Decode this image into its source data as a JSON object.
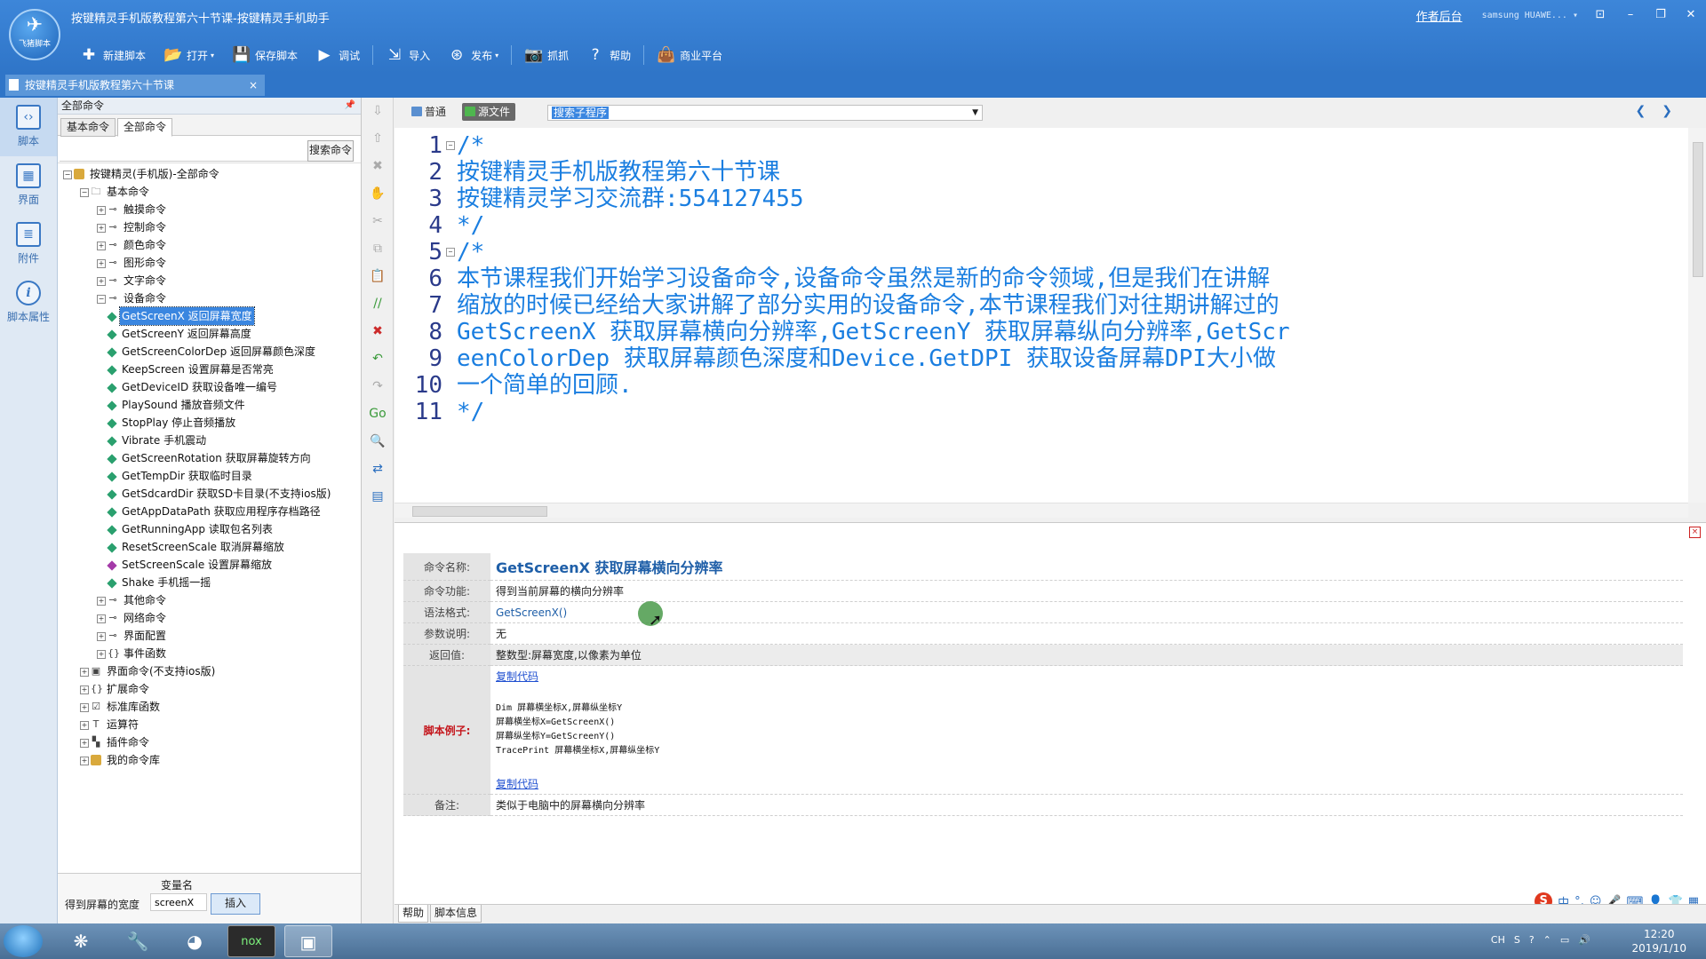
{
  "app": {
    "title": "按键精灵手机版教程第六十节课-按键精灵手机助手",
    "logo_text": "飞猪脚本",
    "author_link": "作者后台",
    "device": "samsung HUAWE...",
    "window_controls": [
      "⊡",
      "–",
      "❐",
      "✕"
    ]
  },
  "toolbar": [
    {
      "label": "新建脚本",
      "icon": "plus-icon",
      "glyph": "✚"
    },
    {
      "label": "打开",
      "icon": "folder-icon",
      "glyph": "📂",
      "dropdown": true
    },
    {
      "label": "保存脚本",
      "icon": "save-icon",
      "glyph": "💾"
    },
    {
      "label": "调试",
      "icon": "play-icon",
      "glyph": "▶"
    },
    {
      "label": "导入",
      "icon": "import-icon",
      "glyph": "⇲"
    },
    {
      "label": "发布",
      "icon": "publish-icon",
      "glyph": "⊛",
      "dropdown": true
    },
    {
      "label": "抓抓",
      "icon": "camera-icon",
      "glyph": "📷"
    },
    {
      "label": "帮助",
      "icon": "help-icon",
      "glyph": "?"
    },
    {
      "label": "商业平台",
      "icon": "bag-icon",
      "glyph": "👜"
    }
  ],
  "doc_tab": {
    "label": "按键精灵手机版教程第六十节课",
    "close": "×"
  },
  "rail": [
    {
      "label": "脚本",
      "icon": "script-icon",
      "glyph": "‹›"
    },
    {
      "label": "界面",
      "icon": "ui-grid-icon",
      "glyph": "▦"
    },
    {
      "label": "附件",
      "icon": "attachment-icon",
      "glyph": "≣"
    },
    {
      "label": "脚本属性",
      "icon": "info-icon",
      "glyph": "i"
    }
  ],
  "cmd_panel": {
    "header": "全部命令",
    "tabs": [
      "基本命令",
      "全部命令"
    ],
    "search_button": "搜索命令",
    "search_value": ""
  },
  "tree": [
    {
      "label": "按键精灵(手机版)-全部命令",
      "level": 0,
      "exp": "-",
      "icon": "root"
    },
    {
      "label": "基本命令",
      "level": 1,
      "exp": "-",
      "icon": "folder"
    },
    {
      "label": "触摸命令",
      "level": 2,
      "exp": "+",
      "icon": "key"
    },
    {
      "label": "控制命令",
      "level": 2,
      "exp": "+",
      "icon": "key"
    },
    {
      "label": "颜色命令",
      "level": 2,
      "exp": "+",
      "icon": "key"
    },
    {
      "label": "图形命令",
      "level": 2,
      "exp": "+",
      "icon": "key"
    },
    {
      "label": "文字命令",
      "level": 2,
      "exp": "+",
      "icon": "key"
    },
    {
      "label": "设备命令",
      "level": 2,
      "exp": "-",
      "icon": "key"
    },
    {
      "label": "GetScreenX 返回屏幕宽度",
      "level": 3,
      "icon": "leaf",
      "selected": true
    },
    {
      "label": "GetScreenY 返回屏幕高度",
      "level": 3,
      "icon": "leaf"
    },
    {
      "label": "GetScreenColorDep 返回屏幕颜色深度",
      "level": 3,
      "icon": "leaf"
    },
    {
      "label": "KeepScreen 设置屏幕是否常亮",
      "level": 3,
      "icon": "leaf"
    },
    {
      "label": "GetDeviceID 获取设备唯一编号",
      "level": 3,
      "icon": "leaf"
    },
    {
      "label": "PlaySound 播放音频文件",
      "level": 3,
      "icon": "leaf"
    },
    {
      "label": "StopPlay 停止音频播放",
      "level": 3,
      "icon": "leaf"
    },
    {
      "label": "Vibrate 手机震动",
      "level": 3,
      "icon": "leaf"
    },
    {
      "label": "GetScreenRotation 获取屏幕旋转方向",
      "level": 3,
      "icon": "leaf"
    },
    {
      "label": "GetTempDir 获取临时目录",
      "level": 3,
      "icon": "leaf"
    },
    {
      "label": "GetSdcardDir 获取SD卡目录(不支持ios版)",
      "level": 3,
      "icon": "leaf"
    },
    {
      "label": "GetAppDataPath 获取应用程序存档路径",
      "level": 3,
      "icon": "leaf"
    },
    {
      "label": "GetRunningApp 读取包名列表",
      "level": 3,
      "icon": "leaf"
    },
    {
      "label": "ResetScreenScale 取消屏幕缩放",
      "level": 3,
      "icon": "leaf"
    },
    {
      "label": "SetScreenScale 设置屏幕缩放",
      "level": 3,
      "icon": "leaf-purple"
    },
    {
      "label": "Shake 手机摇一摇",
      "level": 3,
      "icon": "leaf"
    },
    {
      "label": "其他命令",
      "level": 2,
      "exp": "+",
      "icon": "key"
    },
    {
      "label": "网络命令",
      "level": 2,
      "exp": "+",
      "icon": "key"
    },
    {
      "label": "界面配置",
      "level": 2,
      "exp": "+",
      "icon": "key"
    },
    {
      "label": "事件函数",
      "level": 2,
      "exp": "+",
      "icon": "brace"
    },
    {
      "label": "界面命令(不支持ios版)",
      "level": 1,
      "exp": "+",
      "icon": "ui"
    },
    {
      "label": "扩展命令",
      "level": 1,
      "exp": "+",
      "icon": "brace"
    },
    {
      "label": "标准库函数",
      "level": 1,
      "exp": "+",
      "icon": "lib"
    },
    {
      "label": "运算符",
      "level": 1,
      "exp": "+",
      "icon": "op"
    },
    {
      "label": "插件命令",
      "level": 1,
      "exp": "+",
      "icon": "plugin"
    },
    {
      "label": "我的命令库",
      "level": 1,
      "exp": "+",
      "icon": "root"
    }
  ],
  "var_area": {
    "header": "变量名",
    "desc": "得到屏幕的宽度",
    "value": "screenX",
    "insert_button": "插入"
  },
  "editor": {
    "mode_tabs": [
      "普通",
      "源文件"
    ],
    "active_mode": 1,
    "sub_select": "搜索子程序",
    "lines": [
      {
        "n": "1",
        "fold": "-",
        "text": "/*"
      },
      {
        "n": "2",
        "text": "按键精灵手机版教程第六十节课"
      },
      {
        "n": "3",
        "text": "按键精灵学习交流群:554127455"
      },
      {
        "n": "4",
        "text": "*/"
      },
      {
        "n": "5",
        "fold": "-",
        "text": "/*"
      },
      {
        "n": "6",
        "text": "本节课程我们开始学习设备命令,设备命令虽然是新的命令领域,但是我们在讲解"
      },
      {
        "n": "7",
        "text": "缩放的时候已经给大家讲解了部分实用的设备命令,本节课程我们对往期讲解过的"
      },
      {
        "n": "8",
        "text": "GetScreenX 获取屏幕横向分辨率,GetScreenY 获取屏幕纵向分辨率,GetScr"
      },
      {
        "n": "9",
        "text": "eenColorDep 获取屏幕颜色深度和Device.GetDPI 获取设备屏幕DPI大小做"
      },
      {
        "n": "10",
        "text": "一个简单的回顾."
      },
      {
        "n": "11",
        "text": "*/"
      }
    ]
  },
  "help": {
    "name_label": "命令名称:",
    "name_value": "GetScreenX 获取屏幕横向分辨率",
    "func_label": "命令功能:",
    "func_value": "得到当前屏幕的横向分辨率",
    "syntax_label": "语法格式:",
    "syntax_value": "GetScreenX()",
    "params_label": "参数说明:",
    "params_value": "无",
    "return_label": "返回值:",
    "return_value": "整数型:屏幕宽度,以像素为单位",
    "example_label": "脚本例子:",
    "copy_code": "复制代码",
    "example_lines": [
      "Dim 屏幕横坐标X,屏幕纵坐标Y",
      "屏幕横坐标X=GetScreenX()",
      "屏幕纵坐标Y=GetScreenY()",
      "TracePrint 屏幕横坐标X,屏幕纵坐标Y"
    ],
    "remark_label": "备注:",
    "remark_value": "类似于电脑中的屏幕横向分辨率"
  },
  "bottom_tabs": [
    "帮助",
    "脚本信息"
  ],
  "ime": [
    "S",
    "中",
    "°,",
    "☺",
    "🎤",
    "⌨",
    "👤",
    "👕",
    "▦"
  ],
  "taskbar": {
    "apps": [
      "❋",
      "🔧",
      "◕",
      "nox",
      "▣"
    ],
    "tray": [
      "CH",
      "S",
      "?",
      "⌃",
      "▭",
      "🔊"
    ],
    "time": "12:20",
    "date": "2019/1/10"
  }
}
